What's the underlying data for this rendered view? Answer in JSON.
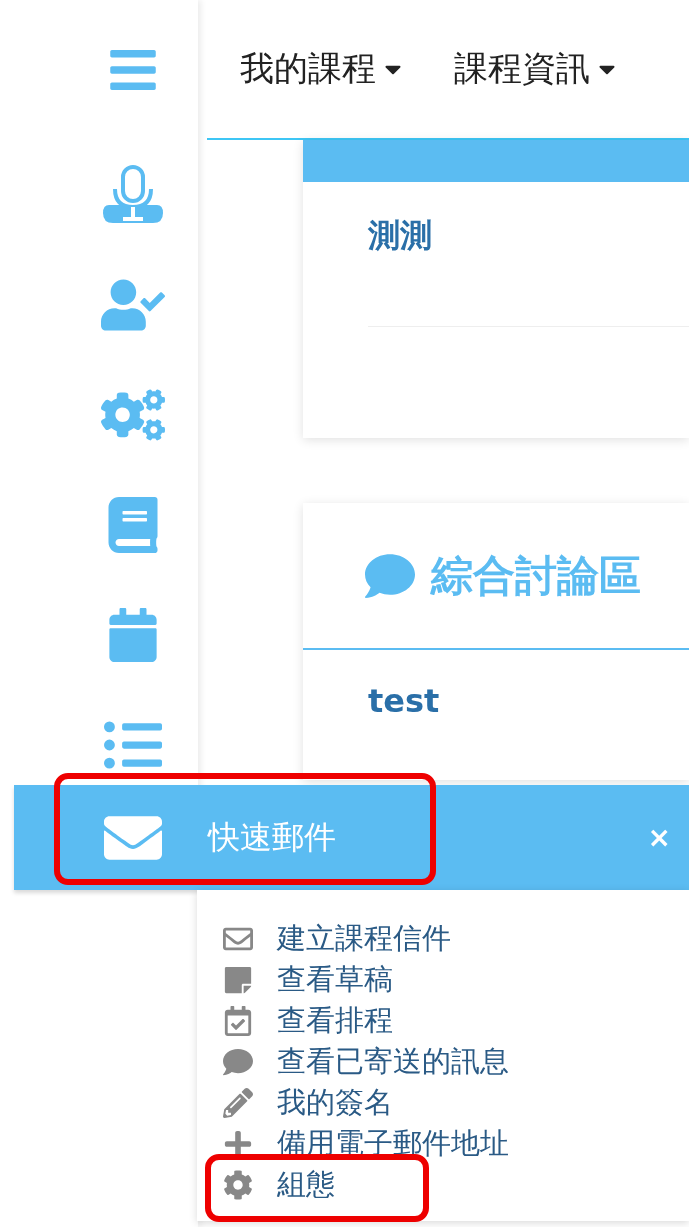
{
  "nav": {
    "items": [
      {
        "label": "我的課程"
      },
      {
        "label": "課程資訊"
      }
    ]
  },
  "cards": [
    {
      "kind": "banner",
      "text": "測測"
    },
    {
      "kind": "forum",
      "title": "綜合討論區",
      "text": "test"
    }
  ],
  "quick_mail": {
    "title": "快速郵件",
    "close": "×",
    "highlighted": true,
    "items": [
      {
        "label": "建立課程信件",
        "highlighted": false
      },
      {
        "label": "查看草稿",
        "highlighted": false
      },
      {
        "label": "查看排程",
        "highlighted": false
      },
      {
        "label": "查看已寄送的訊息",
        "highlighted": false
      },
      {
        "label": "我的簽名",
        "highlighted": false
      },
      {
        "label": "備用電子郵件地址",
        "highlighted": false
      },
      {
        "label": "組態",
        "highlighted": true
      }
    ]
  }
}
